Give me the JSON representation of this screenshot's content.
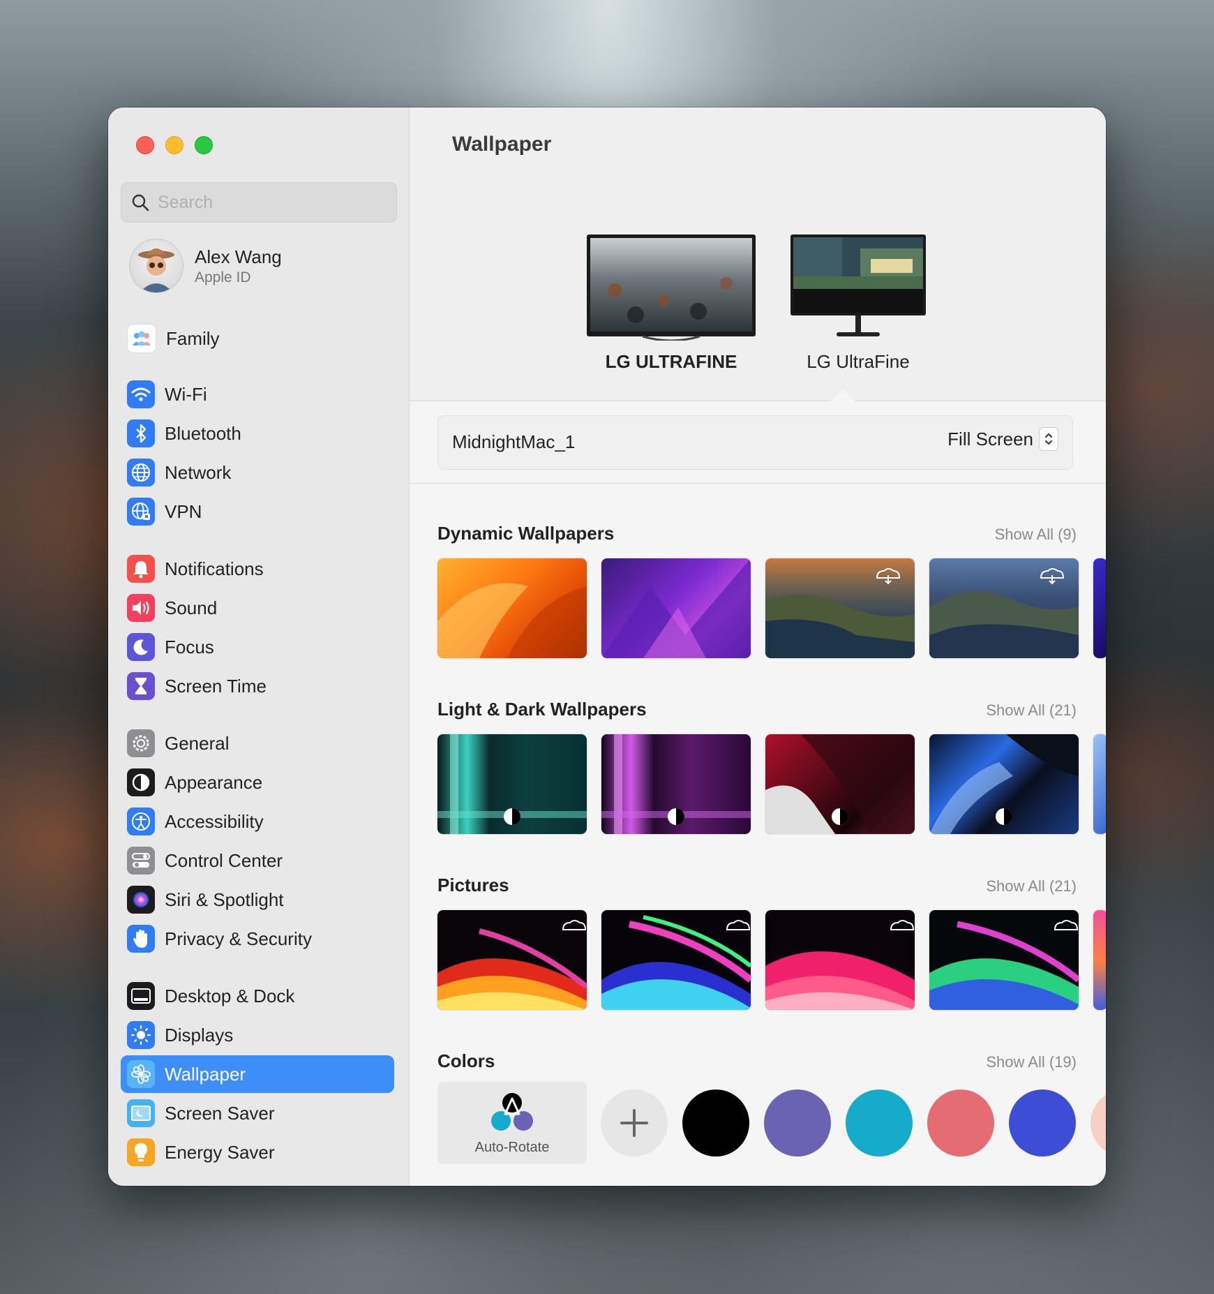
{
  "search": {
    "placeholder": "Search"
  },
  "profile": {
    "name": "Alex Wang",
    "subtitle": "Apple ID"
  },
  "sidebar": {
    "items": [
      {
        "label": "Family",
        "icon": "family-icon",
        "color": "#ffffff"
      },
      {
        "label": "Wi-Fi",
        "icon": "wifi-icon",
        "color": "#2f7cf6"
      },
      {
        "label": "Bluetooth",
        "icon": "bluetooth-icon",
        "color": "#2f7cf6"
      },
      {
        "label": "Network",
        "icon": "globe-icon",
        "color": "#2f7cf6"
      },
      {
        "label": "VPN",
        "icon": "vpn-globe-icon",
        "color": "#2f7cf6"
      },
      {
        "label": "Notifications",
        "icon": "bell-icon",
        "color": "#f3504b"
      },
      {
        "label": "Sound",
        "icon": "speaker-icon",
        "color": "#f3405e"
      },
      {
        "label": "Focus",
        "icon": "moon-icon",
        "color": "#5b56d6"
      },
      {
        "label": "Screen Time",
        "icon": "hourglass-icon",
        "color": "#6a4fd0"
      },
      {
        "label": "General",
        "icon": "gear-icon",
        "color": "#8e8e93"
      },
      {
        "label": "Appearance",
        "icon": "appearance-icon",
        "color": "#1c1c1e"
      },
      {
        "label": "Accessibility",
        "icon": "accessibility-icon",
        "color": "#2f7cf6"
      },
      {
        "label": "Control Center",
        "icon": "toggles-icon",
        "color": "#8e8e93"
      },
      {
        "label": "Siri & Spotlight",
        "icon": "siri-icon",
        "color": "#1c1c1e"
      },
      {
        "label": "Privacy & Security",
        "icon": "hand-icon",
        "color": "#2f7cf6"
      },
      {
        "label": "Desktop & Dock",
        "icon": "dock-icon",
        "color": "#1c1c1e"
      },
      {
        "label": "Displays",
        "icon": "sun-icon",
        "color": "#2f7cf6"
      },
      {
        "label": "Wallpaper",
        "icon": "flower-icon",
        "color": "#3aa6f5",
        "active": true
      },
      {
        "label": "Screen Saver",
        "icon": "screensaver-icon",
        "color": "#43b3f0"
      },
      {
        "label": "Energy Saver",
        "icon": "bulb-icon",
        "color": "#f5a623"
      }
    ]
  },
  "main": {
    "title": "Wallpaper",
    "displays": [
      {
        "label": "LG ULTRAFINE"
      },
      {
        "label": "LG UltraFine"
      }
    ],
    "current_wallpaper": "MidnightMac_1",
    "fit_mode": "Fill Screen",
    "sections": [
      {
        "title": "Dynamic Wallpapers",
        "show_all": "Show All (9)"
      },
      {
        "title": "Light & Dark Wallpapers",
        "show_all": "Show All (21)"
      },
      {
        "title": "Pictures",
        "show_all": "Show All (21)"
      },
      {
        "title": "Colors",
        "show_all": "Show All (19)"
      }
    ],
    "auto_rotate_label": "Auto-Rotate",
    "color_swatches": [
      "#000000",
      "#6a63b3",
      "#16aacb",
      "#e46c72",
      "#3d4dd6",
      "#f6d0c0"
    ]
  }
}
